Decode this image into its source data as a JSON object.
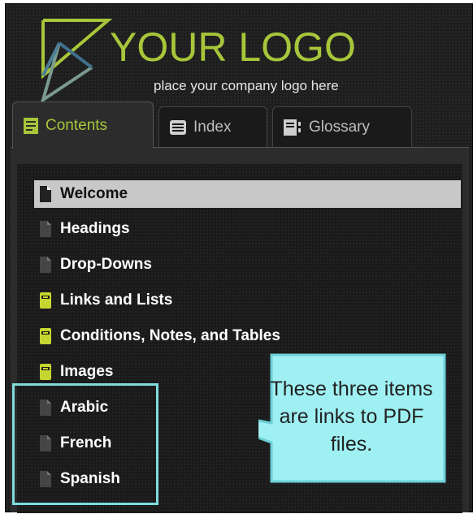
{
  "logo": {
    "title": "YOUR LOGO",
    "subtitle": "place your company logo here",
    "colors": {
      "accent": "#a8c63a"
    }
  },
  "tabs": [
    {
      "label": "Contents",
      "icon": "contents-book-icon",
      "active": true
    },
    {
      "label": "Index",
      "icon": "index-list-icon",
      "active": false
    },
    {
      "label": "Glossary",
      "icon": "glossary-icon",
      "active": false
    }
  ],
  "toc": {
    "items": [
      {
        "label": "Welcome",
        "icon": "page-icon",
        "selected": true
      },
      {
        "label": "Headings",
        "icon": "page-icon",
        "selected": false
      },
      {
        "label": "Drop-Downs",
        "icon": "page-icon",
        "selected": false
      },
      {
        "label": "Links and Lists",
        "icon": "book-icon",
        "selected": false
      },
      {
        "label": "Conditions, Notes, and Tables",
        "icon": "book-icon",
        "selected": false
      },
      {
        "label": "Images",
        "icon": "book-icon",
        "selected": false
      },
      {
        "label": "Arabic",
        "icon": "page-icon",
        "selected": false
      },
      {
        "label": "French",
        "icon": "page-icon",
        "selected": false
      },
      {
        "label": "Spanish",
        "icon": "page-icon",
        "selected": false
      }
    ]
  },
  "callout": {
    "text": "These three items are links to PDF files.",
    "colors": {
      "fill": "#9ff0f2",
      "border": "#6ccfd6"
    }
  }
}
